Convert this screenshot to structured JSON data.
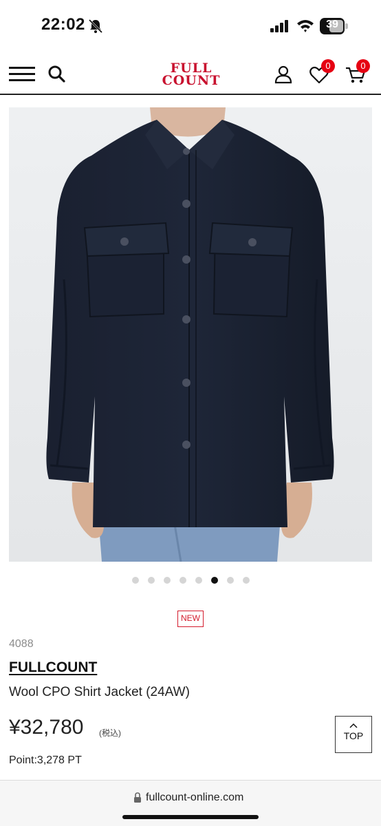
{
  "status_bar": {
    "time": "22:02",
    "battery": "39",
    "icons": [
      "bell-slash-icon",
      "signal-icon",
      "wifi-icon",
      "battery-icon"
    ]
  },
  "header": {
    "logo_line1": "FULL",
    "logo_line2": "COUNT",
    "favorites_count": "0",
    "cart_count": "0",
    "icons": [
      "menu-icon",
      "search-icon",
      "user-icon",
      "heart-icon",
      "cart-icon"
    ],
    "accent_color": "#c8102e",
    "badge_color": "#e60012"
  },
  "gallery": {
    "image_alt": "Wool CPO Shirt Jacket",
    "slide_count": 8,
    "active_index": 5
  },
  "product": {
    "badge": "NEW",
    "code": "4088",
    "brand": "FULLCOUNT",
    "name": "Wool CPO Shirt Jacket (24AW)",
    "price": "¥32,780",
    "tax_note": "(税込)",
    "points": "Point:3,278 PT"
  },
  "top_button": {
    "label": "TOP"
  },
  "browser": {
    "url": "fullcount-online.com"
  }
}
